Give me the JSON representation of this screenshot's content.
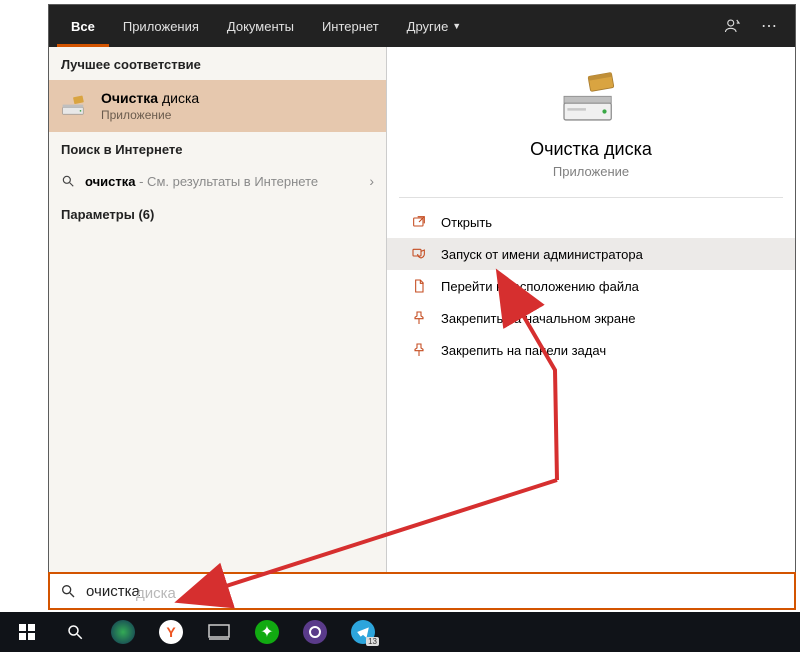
{
  "tabs": {
    "all": "Все",
    "apps": "Приложения",
    "docs": "Документы",
    "web": "Интернет",
    "more": "Другие"
  },
  "left": {
    "best_header": "Лучшее соответствие",
    "best_title_bold": "Очистка",
    "best_title_rest": " диска",
    "best_sub": "Приложение",
    "web_header": "Поиск в Интернете",
    "web_query_bold": "очистка",
    "web_query_rest": " - См. результаты в Интернете",
    "params_header": "Параметры (6)"
  },
  "preview": {
    "title": "Очистка диска",
    "sub": "Приложение"
  },
  "actions": {
    "open": "Открыть",
    "admin": "Запуск от имени администратора",
    "location": "Перейти к расположению файла",
    "pin_start": "Закрепить на начальном экране",
    "pin_task": "Закрепить на панели задач"
  },
  "search": {
    "typed": "очистка",
    "ghost": " диска"
  },
  "colors": {
    "accent": "#d35400",
    "action_icon": "#c44b1f",
    "arrow": "#d62f2f"
  }
}
